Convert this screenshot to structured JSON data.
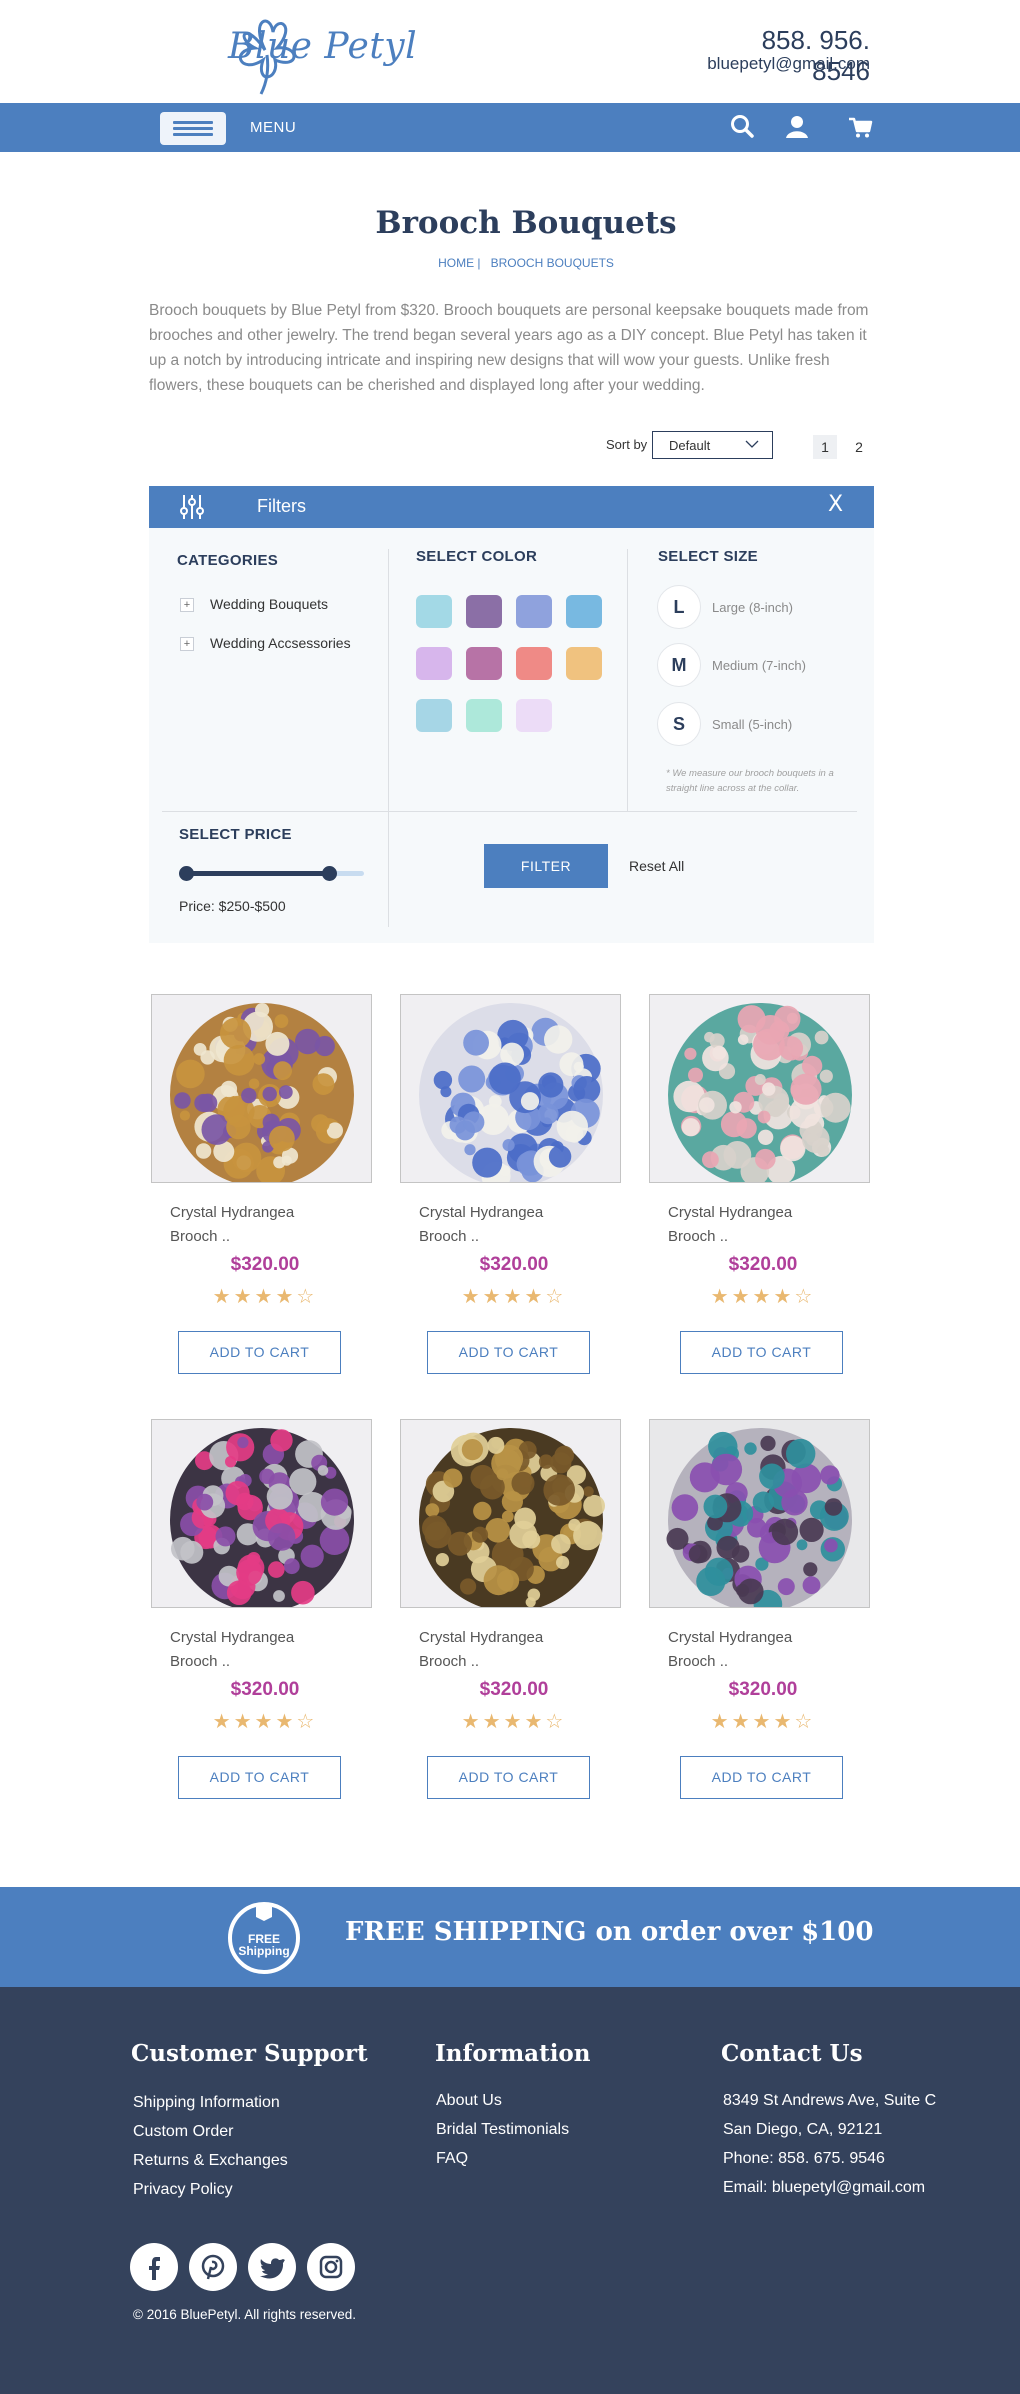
{
  "header": {
    "logo_text": "Blue Petyl",
    "phone": "858. 956. 8546",
    "email": "bluepetyl@gmail.com",
    "menu_label": "MENU"
  },
  "page": {
    "title": "Brooch Bouquets",
    "breadcrumb": [
      "HOME",
      "BROOCH BOUQUETS"
    ],
    "intro": "Brooch bouquets by Blue Petyl from $320. Brooch bouquets are personal keepsake bouquets made from brooches and other jewelry. The trend began several years ago as a DIY concept. Blue Petyl has taken it up a notch by introducing intricate and inspiring new designs that will wow your guests. Unlike fresh flowers, these bouquets can be cherished and displayed long after your wedding."
  },
  "sort": {
    "label": "Sort by",
    "value": "Default"
  },
  "pagination": {
    "pages": [
      "1",
      "2"
    ],
    "active": "1"
  },
  "filters": {
    "title": "Filters",
    "close": "X",
    "categories_heading": "CATEGORIES",
    "categories": [
      "Wedding Bouquets",
      "Wedding Accsessories"
    ],
    "color_heading": "SELECT COLOR",
    "colors": [
      "#a3d9e6",
      "#8b6fa6",
      "#8fa2dd",
      "#78b9e1",
      "#d7b6ec",
      "#b773a6",
      "#ef8a86",
      "#f0c27f",
      "#a6d6e6",
      "#ade8da",
      "#ecdcf7"
    ],
    "size_heading": "SELECT SIZE",
    "sizes": [
      {
        "letter": "L",
        "label": "Large (8-inch)"
      },
      {
        "letter": "M",
        "label": "Medium (7-inch)"
      },
      {
        "letter": "S",
        "label": "Small  (5-inch)"
      }
    ],
    "size_note": "* We measure our brooch bouquets in a straight line across at the collar.",
    "price_heading": "SELECT PRICE",
    "price_label": "Price: $250-$500",
    "price_range_fraction": [
      0,
      0.8
    ],
    "filter_button": "FILTER",
    "reset": "Reset All"
  },
  "products": [
    {
      "name_line1": "Crystal Hydrangea",
      "name_line2": "Brooch ..",
      "price": "$320.00",
      "stars": "★★★★☆",
      "rating": 4,
      "cart": "ADD TO CART",
      "palette": [
        "#c8943e",
        "#efe6cf",
        "#7a56a5",
        "#b38141"
      ]
    },
    {
      "name_line1": "Crystal Hydrangea",
      "name_line2": "Brooch ..",
      "price": "$320.00",
      "stars": "★★★★☆",
      "rating": 4,
      "cart": "ADD TO CART",
      "palette": [
        "#4b6dc8",
        "#f2f1ea",
        "#7893d9",
        "#dcdde8"
      ]
    },
    {
      "name_line1": "Crystal Hydrangea",
      "name_line2": "Brooch ..",
      "price": "$320.00",
      "stars": "★★★★☆",
      "rating": 4,
      "cart": "ADD TO CART",
      "palette": [
        "#f1e4e0",
        "#e9a6b3",
        "#d8d1cb",
        "#5aa8a0"
      ]
    },
    {
      "name_line1": "Crystal Hydrangea",
      "name_line2": "Brooch ..",
      "price": "$320.00",
      "stars": "★★★★☆",
      "rating": 4,
      "cart": "ADD TO CART",
      "palette": [
        "#8a4ea8",
        "#e43c86",
        "#c2c2c8",
        "#3c3444"
      ]
    },
    {
      "name_line1": "Crystal Hydrangea",
      "name_line2": "Brooch ..",
      "price": "$320.00",
      "stars": "★★★★☆",
      "rating": 4,
      "cart": "ADD TO CART",
      "palette": [
        "#b89245",
        "#7a5a2a",
        "#e1cf98",
        "#4a3a22"
      ]
    },
    {
      "name_line1": "Crystal Hydrangea",
      "name_line2": "Brooch ..",
      "price": "$320.00",
      "stars": "★★★★☆",
      "rating": 4,
      "cart": "ADD TO CART",
      "palette": [
        "#2f8f9c",
        "#8a4fb0",
        "#4a3a52",
        "#b5b2bd"
      ]
    }
  ],
  "shipping": {
    "badge_line1": "FREE",
    "badge_line2": "Shipping",
    "text": "FREE SHIPPING on order over $100"
  },
  "footer": {
    "support": {
      "heading": "Customer Support",
      "links": [
        "Shipping Information",
        "Custom Order",
        "Returns & Exchanges",
        "Privacy Policy"
      ]
    },
    "info": {
      "heading": "Information",
      "links": [
        "About Us",
        "Bridal Testimonials",
        "FAQ"
      ]
    },
    "contact": {
      "heading": "Contact Us",
      "lines": [
        "8349 St Andrews Ave, Suite C",
        "San Diego, CA, 92121",
        "Phone: 858. 675. 9546",
        "Email: bluepetyl@gmail.com"
      ]
    },
    "social": [
      "facebook-icon",
      "pinterest-icon",
      "twitter-icon",
      "instagram-icon"
    ],
    "copyright": "©  2016 BluePetyl. All rights reserved."
  },
  "colors": {
    "brand_blue": "#4c7fbf",
    "navy": "#2c3e5c",
    "footer_bg": "#34425c",
    "price": "#b03f9a",
    "stars": "#e9b870"
  }
}
